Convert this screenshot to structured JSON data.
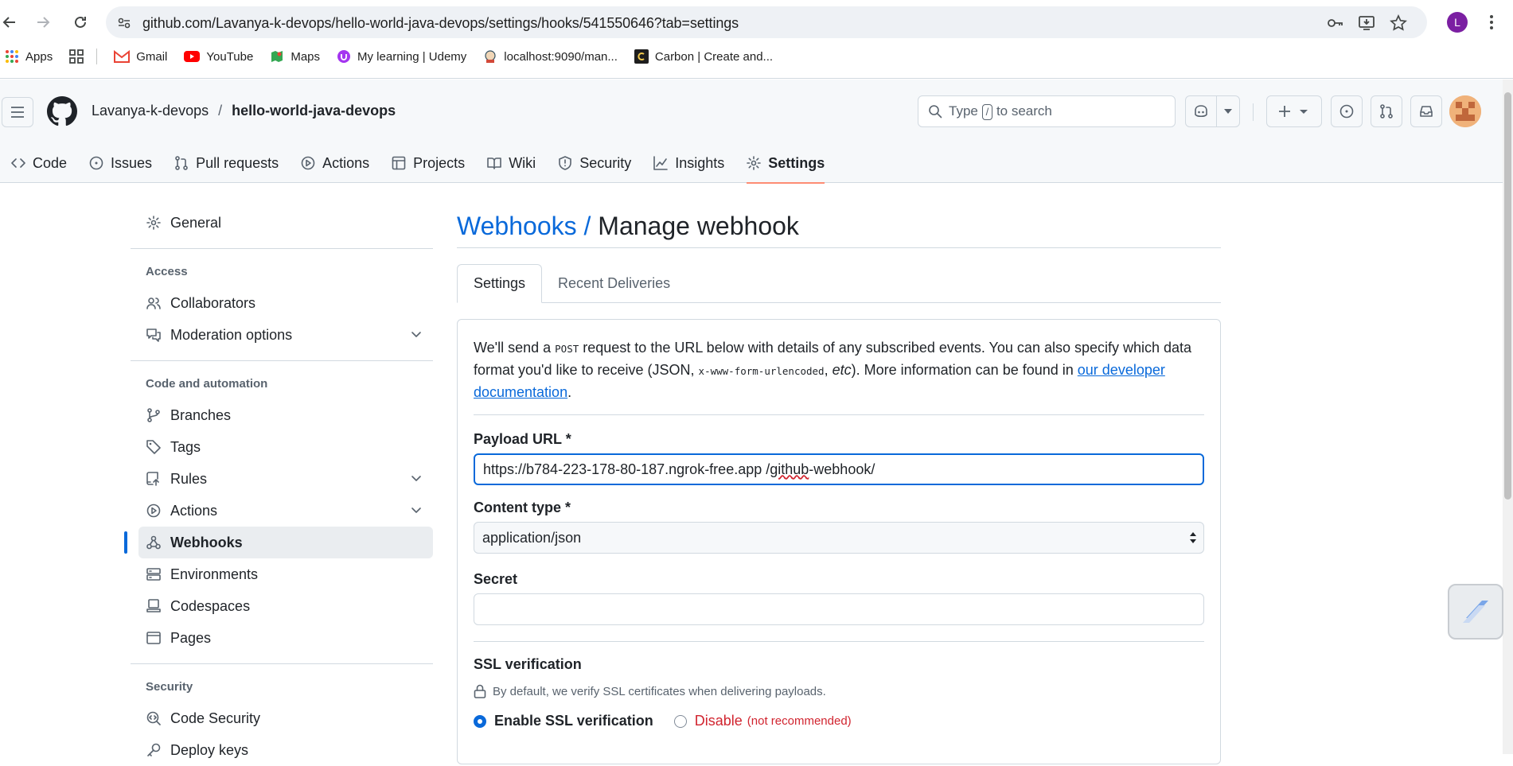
{
  "browser": {
    "url": "github.com/Lavanya-k-devops/hello-world-java-devops/settings/hooks/541550646?tab=settings",
    "profile_initial": "L",
    "bookmarks": [
      {
        "label": "Apps",
        "icon": "apps-grid-icon",
        "color": "#ea4335"
      },
      {
        "label": "",
        "icon": "tab-groups-icon",
        "color": "#444746"
      },
      {
        "label": "Gmail",
        "icon": "gmail-icon",
        "color": "#ea4335"
      },
      {
        "label": "YouTube",
        "icon": "youtube-icon",
        "color": "#ff0000"
      },
      {
        "label": "Maps",
        "icon": "maps-icon",
        "color": "#34a853"
      },
      {
        "label": "My learning | Udemy",
        "icon": "udemy-icon",
        "color": "#a435f0"
      },
      {
        "label": "localhost:9090/man...",
        "icon": "jenkins-icon",
        "color": "#d24939"
      },
      {
        "label": "Carbon | Create and...",
        "icon": "carbon-icon",
        "color": "#1e1e1e"
      }
    ]
  },
  "header": {
    "owner": "Lavanya-k-devops",
    "separator": "/",
    "repo": "hello-world-java-devops",
    "search_type": "Type",
    "search_key": "/",
    "search_rest": "to search"
  },
  "repo_tabs": [
    {
      "label": "Code",
      "icon": "code-icon"
    },
    {
      "label": "Issues",
      "icon": "issue-icon"
    },
    {
      "label": "Pull requests",
      "icon": "pull-request-icon"
    },
    {
      "label": "Actions",
      "icon": "play-icon"
    },
    {
      "label": "Projects",
      "icon": "table-icon"
    },
    {
      "label": "Wiki",
      "icon": "book-icon"
    },
    {
      "label": "Security",
      "icon": "shield-icon"
    },
    {
      "label": "Insights",
      "icon": "graph-icon"
    },
    {
      "label": "Settings",
      "icon": "gear-icon",
      "selected": true
    }
  ],
  "sidebar": {
    "general": "General",
    "access_heading": "Access",
    "collaborators": "Collaborators",
    "moderation": "Moderation options",
    "code_heading": "Code and automation",
    "branches": "Branches",
    "tags": "Tags",
    "rules": "Rules",
    "actions": "Actions",
    "webhooks": "Webhooks",
    "environments": "Environments",
    "codespaces": "Codespaces",
    "pages": "Pages",
    "security_heading": "Security",
    "code_security": "Code Security",
    "deploy_keys": "Deploy keys"
  },
  "main": {
    "title_link": "Webhooks /",
    "title_rest": "Manage webhook",
    "tab_settings": "Settings",
    "tab_deliveries": "Recent Deliveries",
    "intro_1": "We'll send a ",
    "intro_post": "POST",
    "intro_2": " request to the URL below with details of any subscribed events. You can also specify which data format you'd like to receive (JSON, ",
    "intro_code": "x-www-form-urlencoded",
    "intro_3": ", ",
    "intro_etc": "etc",
    "intro_4": "). More information can be found in ",
    "intro_link": "our developer documentation",
    "intro_5": ".",
    "payload_label": "Payload URL *",
    "payload_value_a": "https://b784-223-178-80-187.ngrok-free.app /",
    "payload_value_b": "github",
    "payload_value_c": "-webhook/",
    "content_type_label": "Content type *",
    "content_type_value": "application/json",
    "secret_label": "Secret",
    "secret_value": "",
    "ssl_heading": "SSL verification",
    "ssl_note": "By default, we verify SSL certificates when delivering payloads.",
    "ssl_enable": "Enable SSL verification",
    "ssl_disable": "Disable",
    "ssl_disable_note": "(not recommended)"
  },
  "colors": {
    "accent": "#0969da",
    "danger": "#d1242f",
    "tab_underline": "#fd8c73"
  }
}
